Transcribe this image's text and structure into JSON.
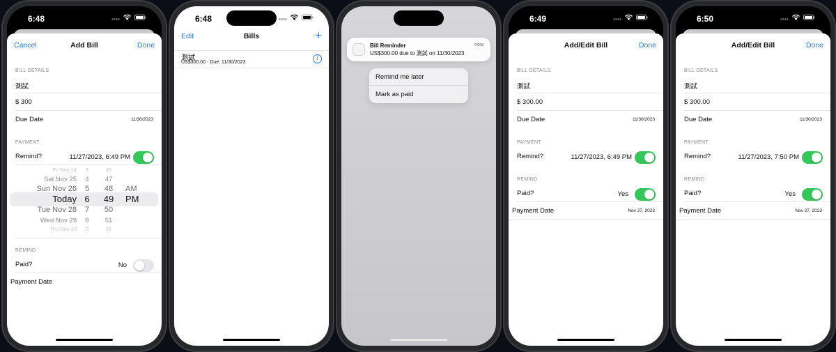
{
  "screens": [
    {
      "time": "6:48",
      "nav": {
        "left": "Cancel",
        "title": "Add Bill",
        "right": "Done"
      },
      "section_details": "BILL DETAILS",
      "name_value": "測試",
      "amount_value": "$  300",
      "due_label": "Due Date",
      "due_value": "11/30/2023",
      "section_payment": "PAYMENT",
      "remind_label": "Remind?",
      "remind_value": "11/27/2023, 6:49 PM",
      "remind_on": true,
      "picker": [
        {
          "day": "Fri Nov 24",
          "h": "3",
          "m": "46",
          "ap": ""
        },
        {
          "day": "Sat Nov 25",
          "h": "4",
          "m": "47",
          "ap": ""
        },
        {
          "day": "Sun Nov 26",
          "h": "5",
          "m": "48",
          "ap": "AM"
        },
        {
          "day": "Today",
          "h": "6",
          "m": "49",
          "ap": "PM"
        },
        {
          "day": "Tue Nov 28",
          "h": "7",
          "m": "50",
          "ap": ""
        },
        {
          "day": "Wed Nov 29",
          "h": "8",
          "m": "51",
          "ap": ""
        },
        {
          "day": "Thu Nov 30",
          "h": "9",
          "m": "52",
          "ap": ""
        }
      ],
      "section_remind": "REMIND",
      "paid_label": "Paid?",
      "paid_value": "No",
      "paid_on": false,
      "payment_date_label": "Payment Date"
    },
    {
      "time": "6:48",
      "nav": {
        "left": "Edit",
        "title": "Bills",
        "right": "+"
      },
      "bill_title": "測試",
      "bill_sub": "US$300.00 - Due: 11/30/2023"
    },
    {
      "notification": {
        "title": "Bill Reminder",
        "body": "US$300.00 due to 測試 on 11/30/2023",
        "time": "now"
      },
      "actions": [
        "Remind me later",
        "Mark as paid"
      ]
    },
    {
      "time": "6:49",
      "nav": {
        "left": "",
        "title": "Add/Edit Bill",
        "right": "Done"
      },
      "section_details": "BILL DETAILS",
      "name_value": "測試",
      "amount_value": "$  300.00",
      "due_label": "Due Date",
      "due_value": "11/30/2023",
      "section_payment": "PAYMENT",
      "remind_label": "Remind?",
      "remind_value": "11/27/2023, 6:49 PM",
      "remind_on": true,
      "section_remind": "REMIND",
      "paid_label": "Paid?",
      "paid_value": "Yes",
      "paid_on": true,
      "payment_date_label": "Payment Date",
      "payment_date_value": "Nov 27, 2023"
    },
    {
      "time": "6:50",
      "nav": {
        "left": "",
        "title": "Add/Edit Bill",
        "right": "Done"
      },
      "section_details": "BILL DETAILS",
      "name_value": "測試",
      "amount_value": "$  300.00",
      "due_label": "Due Date",
      "due_value": "11/30/2023",
      "section_payment": "PAYMENT",
      "remind_label": "Remind?",
      "remind_value": "11/27/2023, 7:50 PM",
      "remind_on": true,
      "section_remind": "REMIND",
      "paid_label": "Paid?",
      "paid_value": "Yes",
      "paid_on": true,
      "payment_date_label": "Payment Date",
      "payment_date_value": "Nov 27, 2023"
    }
  ]
}
